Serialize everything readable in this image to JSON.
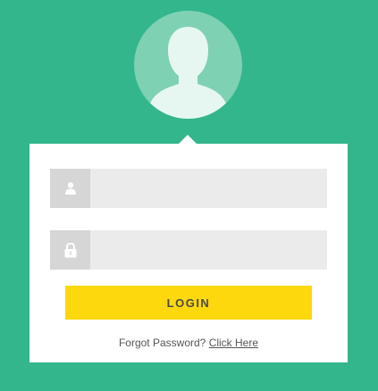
{
  "avatar": {
    "icon": "user-silhouette-icon"
  },
  "username": {
    "icon": "user-icon",
    "value": "",
    "placeholder": ""
  },
  "password": {
    "icon": "lock-icon",
    "value": "",
    "placeholder": ""
  },
  "login": {
    "label": "LOGIN"
  },
  "forgot": {
    "text": "Forgot Password?",
    "link": "Click Here"
  },
  "colors": {
    "background": "#33b68b",
    "avatar_circle": "#7fd1b3",
    "silhouette": "#e6f7f1",
    "button": "#fdd80d",
    "field": "#ebebeb",
    "icon_box": "#d6d6d6"
  }
}
